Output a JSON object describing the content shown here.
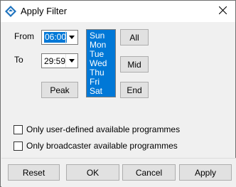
{
  "window": {
    "title": "Apply Filter"
  },
  "icons": {
    "app": "filter-app-icon",
    "close": "close-icon",
    "dropdown": "chevron-down-icon"
  },
  "labels": {
    "from": "From",
    "to": "To"
  },
  "from_combo": {
    "value": "06:00"
  },
  "to_combo": {
    "value": "29:59"
  },
  "days": [
    "Sun",
    "Mon",
    "Tue",
    "Wed",
    "Thu",
    "Fri",
    "Sat"
  ],
  "buttons": {
    "peak": "Peak",
    "all": "All",
    "mid": "Mid",
    "end": "End",
    "reset": "Reset",
    "ok": "OK",
    "cancel": "Cancel",
    "apply": "Apply"
  },
  "checkboxes": [
    {
      "label": "Only user-defined available programmes",
      "checked": false
    },
    {
      "label": "Only broadcaster available programmes",
      "checked": false
    }
  ],
  "colors": {
    "selection": "#0078d7",
    "accent_icon": "#1e73be"
  }
}
